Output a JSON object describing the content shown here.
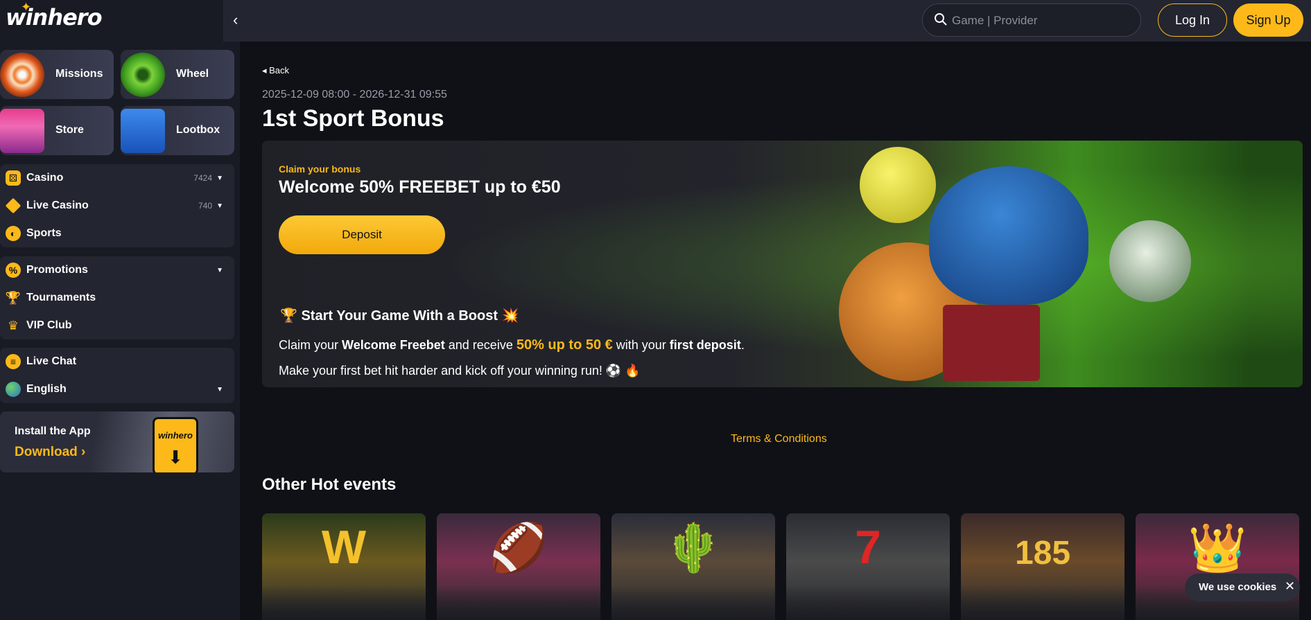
{
  "brand": {
    "logo": "winhero"
  },
  "tiles": [
    {
      "label": "Missions"
    },
    {
      "label": "Wheel"
    },
    {
      "label": "Store"
    },
    {
      "label": "Lootbox"
    }
  ],
  "nav": {
    "casino": {
      "label": "Casino",
      "count": "7424"
    },
    "live_casino": {
      "label": "Live Casino",
      "count": "740"
    },
    "sports": {
      "label": "Sports"
    },
    "promotions": {
      "label": "Promotions"
    },
    "tournaments": {
      "label": "Tournaments"
    },
    "vip": {
      "label": "VIP Club"
    },
    "live_chat": {
      "label": "Live Chat"
    },
    "language": {
      "label": "English"
    }
  },
  "install": {
    "title": "Install the App",
    "cta": "Download ›",
    "phone_logo": "winhero"
  },
  "header": {
    "search_placeholder": "Game | Provider",
    "login": "Log In",
    "signup": "Sign Up"
  },
  "page": {
    "back": "Back",
    "dates": "2025-12-09 08:00 - 2026-12-31 09:55",
    "title": "1st Sport Bonus"
  },
  "banner": {
    "claim": "Claim your bonus",
    "headline": "Welcome 50% FREEBET up to €50",
    "deposit": "Deposit",
    "boost_title": "🏆 Start Your Game With a Boost 💥",
    "line1_a": "Claim your ",
    "line1_b": "Welcome Freebet",
    "line1_c": " and receive ",
    "line1_d": "50% up to 50 €",
    "line1_e": " with your ",
    "line1_f": "first deposit",
    "line1_g": ".",
    "line2": "Make your first bet hit harder and kick off your winning run! ⚽ 🔥"
  },
  "terms": "Terms & Conditions",
  "hot_events": {
    "title": "Other Hot events",
    "cards": [
      {
        "symbol": "W",
        "color": "#f3c12c"
      },
      {
        "symbol": "🏈",
        "color": "#c14a2a"
      },
      {
        "symbol": "🌵",
        "color": "#66b33a"
      },
      {
        "symbol": "7",
        "color": "#e02525"
      },
      {
        "symbol": "185",
        "color": "#f0c040"
      },
      {
        "symbol": "👑",
        "color": "#c23a4a"
      }
    ]
  },
  "cookie": {
    "text": "We use cookies",
    "close": "✕"
  },
  "colors": {
    "accent": "#fcb919",
    "bg": "#101116",
    "sidebar": "#191b24"
  }
}
